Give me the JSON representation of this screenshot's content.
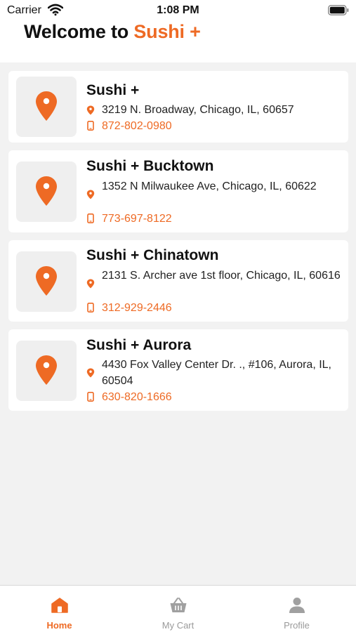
{
  "status_bar": {
    "carrier": "Carrier",
    "time": "1:08 PM"
  },
  "header": {
    "title_prefix": "Welcome to ",
    "title_brand": "Sushi +"
  },
  "locations": [
    {
      "name": "Sushi +",
      "address": "3219 N. Broadway, Chicago, IL, 60657",
      "phone": "872-802-0980"
    },
    {
      "name": "Sushi + Bucktown",
      "address": "1352 N Milwaukee Ave, Chicago, IL, 60622",
      "phone": "773-697-8122"
    },
    {
      "name": "Sushi + Chinatown",
      "address": "2131 S. Archer ave 1st floor, Chicago, IL, 60616",
      "phone": "312-929-2446"
    },
    {
      "name": "Sushi + Aurora",
      "address": "4430 Fox Valley Center Dr. ., #106, Aurora, IL, 60504",
      "phone": "630-820-1666"
    }
  ],
  "tabbar": {
    "tabs": [
      {
        "label": "Home",
        "icon": "home-icon",
        "active": true
      },
      {
        "label": "My Cart",
        "icon": "basket-icon",
        "active": false
      },
      {
        "label": "Profile",
        "icon": "person-icon",
        "active": false
      }
    ]
  },
  "colors": {
    "accent": "#ee6a24",
    "background": "#f2f2f2",
    "card": "#ffffff",
    "inactive": "#9a9a9a"
  }
}
